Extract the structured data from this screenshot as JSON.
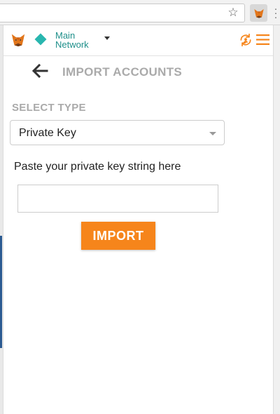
{
  "browser": {
    "star_icon": "star-icon",
    "extension_icon": "metamask-fox-icon",
    "more_icon": "vertical-dots-icon"
  },
  "header": {
    "logo_icon": "metamask-fox-icon",
    "network": {
      "line1": "Main",
      "line2": "Network",
      "indicator_color": "#29b6af"
    },
    "sync_icon": "sync-icon",
    "menu_icon": "hamburger-menu-icon"
  },
  "page": {
    "back_icon": "arrow-left-icon",
    "title": "IMPORT ACCOUNTS"
  },
  "form": {
    "select_label": "SELECT TYPE",
    "selected_type": "Private Key",
    "paste_label": "Paste your private key string here",
    "key_value": "",
    "import_label": "IMPORT"
  },
  "colors": {
    "accent": "#f6851b",
    "network_teal": "#29b6af",
    "muted_label": "#aaaaaa"
  }
}
